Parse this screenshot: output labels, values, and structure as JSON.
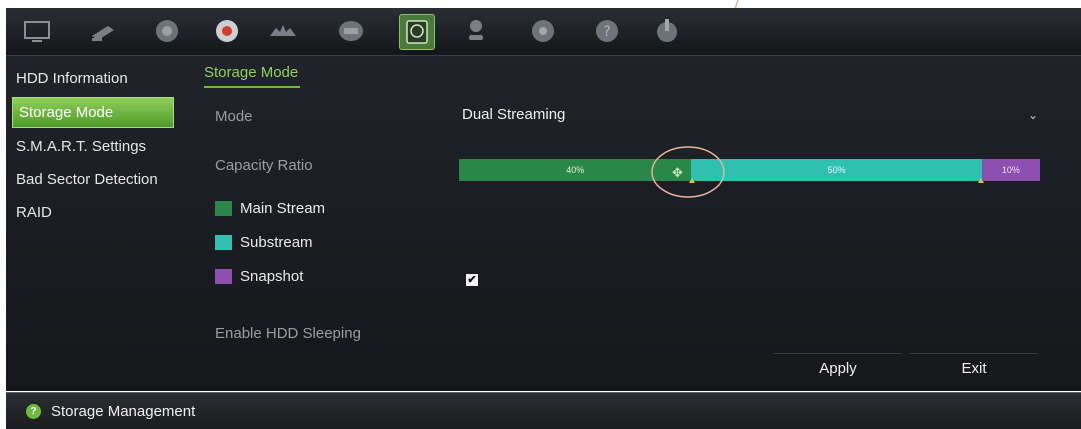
{
  "toolbar": {
    "icons": [
      "monitor-icon",
      "camera-icon",
      "network-icon",
      "record-icon",
      "alarm-icon",
      "device-icon",
      "storage-icon",
      "user-icon",
      "system-icon",
      "help-icon",
      "shutdown-icon"
    ],
    "active": "storage-icon"
  },
  "sidebar": {
    "items": [
      {
        "label": "HDD Information"
      },
      {
        "label": "Storage Mode"
      },
      {
        "label": "S.M.A.R.T. Settings"
      },
      {
        "label": "Bad Sector Detection"
      },
      {
        "label": "RAID"
      }
    ],
    "active_index": 1
  },
  "main": {
    "tab_title": "Storage Mode",
    "mode_label": "Mode",
    "mode_value": "Dual Streaming",
    "capacity_label": "Capacity Ratio",
    "capacity": {
      "main": {
        "percent": 40,
        "text": "40%"
      },
      "sub": {
        "percent": 50,
        "text": "50%"
      },
      "snap": {
        "percent": 10,
        "text": "10%"
      }
    },
    "legend": [
      {
        "label": "Main Stream",
        "color": "#29884a"
      },
      {
        "label": "Substream",
        "color": "#2fc0b0"
      },
      {
        "label": "Snapshot",
        "color": "#8d4fb0"
      }
    ],
    "sleep_label": "Enable HDD Sleeping",
    "sleep_checked": true,
    "apply_label": "Apply",
    "exit_label": "Exit"
  },
  "footer": {
    "title": "Storage Management"
  },
  "colors": {
    "accent": "#6dbb3f",
    "annotation": "#e8b49a"
  }
}
